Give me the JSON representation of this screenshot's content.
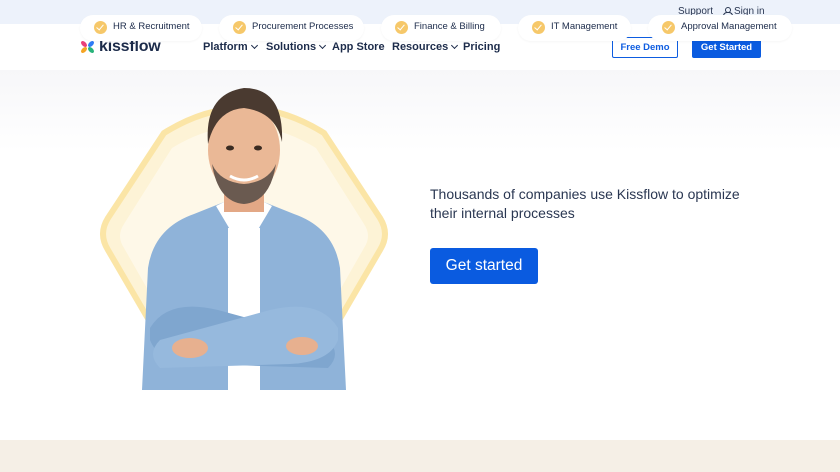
{
  "topbar": {
    "support": "Support",
    "sign_in": "Sign in",
    "sign_in_icon": "user-icon"
  },
  "nav": {
    "logo_text": "kissflow",
    "items": [
      {
        "label": "Platform",
        "has_dropdown": true
      },
      {
        "label": "Solutions",
        "has_dropdown": true
      },
      {
        "label": "App Store",
        "has_dropdown": false
      },
      {
        "label": "Resources",
        "has_dropdown": true
      },
      {
        "label": "Pricing",
        "has_dropdown": false
      }
    ],
    "free_demo": "Free Demo",
    "get_started": "Get Started"
  },
  "hero": {
    "text": "Thousands of companies use Kissflow to optimize their internal processes",
    "cta": "Get started"
  },
  "categories": [
    "HR & Recruitment",
    "Procurement Processes",
    "Finance & Billing",
    "IT Management",
    "Approval Management"
  ],
  "colors": {
    "primary": "#0a5be0",
    "text": "#1c2b4a",
    "topbar_bg": "#edf2fb",
    "category_bg": "#f5efe6",
    "check": "#f6c86a"
  }
}
